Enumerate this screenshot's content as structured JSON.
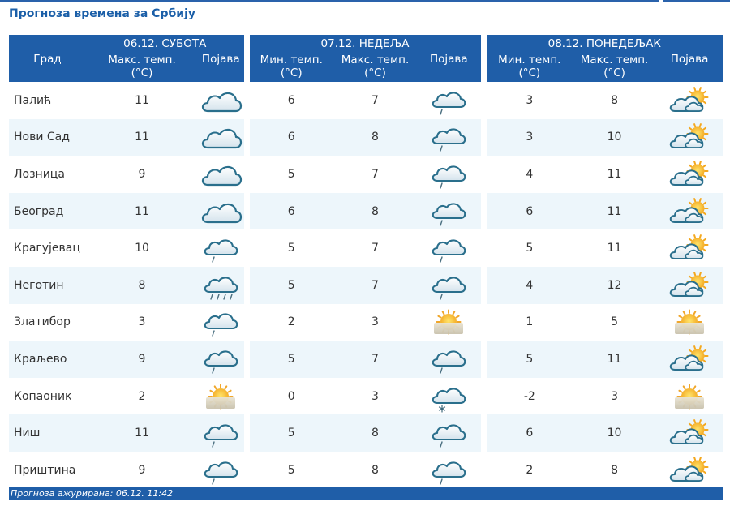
{
  "page": {
    "title": "Прогноза времена за Србију"
  },
  "header": {
    "city_label": "Град",
    "days": [
      {
        "date": "06.12. СУБОТА",
        "cols": [
          "Макс. темп.",
          "Појава"
        ]
      },
      {
        "date": "07.12. НЕДЕЉА",
        "cols": [
          "Мин. темп.",
          "Макс. темп.",
          "Појава"
        ]
      },
      {
        "date": "08.12. ПОНЕДЕЉАК",
        "cols": [
          "Мин. темп.",
          "Макс. темп.",
          "Појава"
        ]
      }
    ],
    "unit": "(°C)"
  },
  "colors": {
    "header_bg": "#1f5ea8",
    "row_alt_bg": "#edf6fb",
    "title": "#1b5fa8"
  },
  "rows": [
    {
      "city": "Палић",
      "d1_max": "11",
      "d1_icon": "cloud-icon",
      "d2_min": "6",
      "d2_max": "7",
      "d2_icon": "cloud-rain-icon",
      "d3_min": "3",
      "d3_max": "8",
      "d3_icon": "sun-cloud-icon"
    },
    {
      "city": "Нови Сад",
      "d1_max": "11",
      "d1_icon": "cloud-icon",
      "d2_min": "6",
      "d2_max": "8",
      "d2_icon": "cloud-rain-icon",
      "d3_min": "3",
      "d3_max": "10",
      "d3_icon": "sun-cloud-icon"
    },
    {
      "city": "Лозница",
      "d1_max": "9",
      "d1_icon": "cloud-icon",
      "d2_min": "5",
      "d2_max": "7",
      "d2_icon": "cloud-rain-icon",
      "d3_min": "4",
      "d3_max": "11",
      "d3_icon": "sun-cloud-icon"
    },
    {
      "city": "Београд",
      "d1_max": "11",
      "d1_icon": "cloud-icon",
      "d2_min": "6",
      "d2_max": "8",
      "d2_icon": "cloud-rain-icon",
      "d3_min": "6",
      "d3_max": "11",
      "d3_icon": "sun-cloud-icon"
    },
    {
      "city": "Крагујевац",
      "d1_max": "10",
      "d1_icon": "cloud-rain-icon",
      "d2_min": "5",
      "d2_max": "7",
      "d2_icon": "cloud-rain-icon",
      "d3_min": "5",
      "d3_max": "11",
      "d3_icon": "sun-cloud-icon"
    },
    {
      "city": "Неготин",
      "d1_max": "8",
      "d1_icon": "cloud-heavy-rain-icon",
      "d2_min": "5",
      "d2_max": "7",
      "d2_icon": "cloud-rain-icon",
      "d3_min": "4",
      "d3_max": "12",
      "d3_icon": "sun-cloud-icon"
    },
    {
      "city": "Златибор",
      "d1_max": "3",
      "d1_icon": "cloud-rain-icon",
      "d2_min": "2",
      "d2_max": "3",
      "d2_icon": "sun-fog-icon",
      "d3_min": "1",
      "d3_max": "5",
      "d3_icon": "sun-fog-icon"
    },
    {
      "city": "Краљево",
      "d1_max": "9",
      "d1_icon": "cloud-rain-icon",
      "d2_min": "5",
      "d2_max": "7",
      "d2_icon": "cloud-rain-icon",
      "d3_min": "5",
      "d3_max": "11",
      "d3_icon": "sun-cloud-icon"
    },
    {
      "city": "Копаоник",
      "d1_max": "2",
      "d1_icon": "sun-fog-icon",
      "d2_min": "0",
      "d2_max": "3",
      "d2_icon": "cloud-snow-icon",
      "d3_min": "-2",
      "d3_max": "3",
      "d3_icon": "sun-fog-icon"
    },
    {
      "city": "Ниш",
      "d1_max": "11",
      "d1_icon": "cloud-rain-icon",
      "d2_min": "5",
      "d2_max": "8",
      "d2_icon": "cloud-rain-icon",
      "d3_min": "6",
      "d3_max": "10",
      "d3_icon": "sun-cloud-icon"
    },
    {
      "city": "Приштина",
      "d1_max": "9",
      "d1_icon": "cloud-rain-icon",
      "d2_min": "5",
      "d2_max": "8",
      "d2_icon": "cloud-rain-icon",
      "d3_min": "2",
      "d3_max": "8",
      "d3_icon": "sun-cloud-icon"
    }
  ],
  "footer": {
    "updated": "Прогноза ажурирана:  06.12. 11:42"
  }
}
